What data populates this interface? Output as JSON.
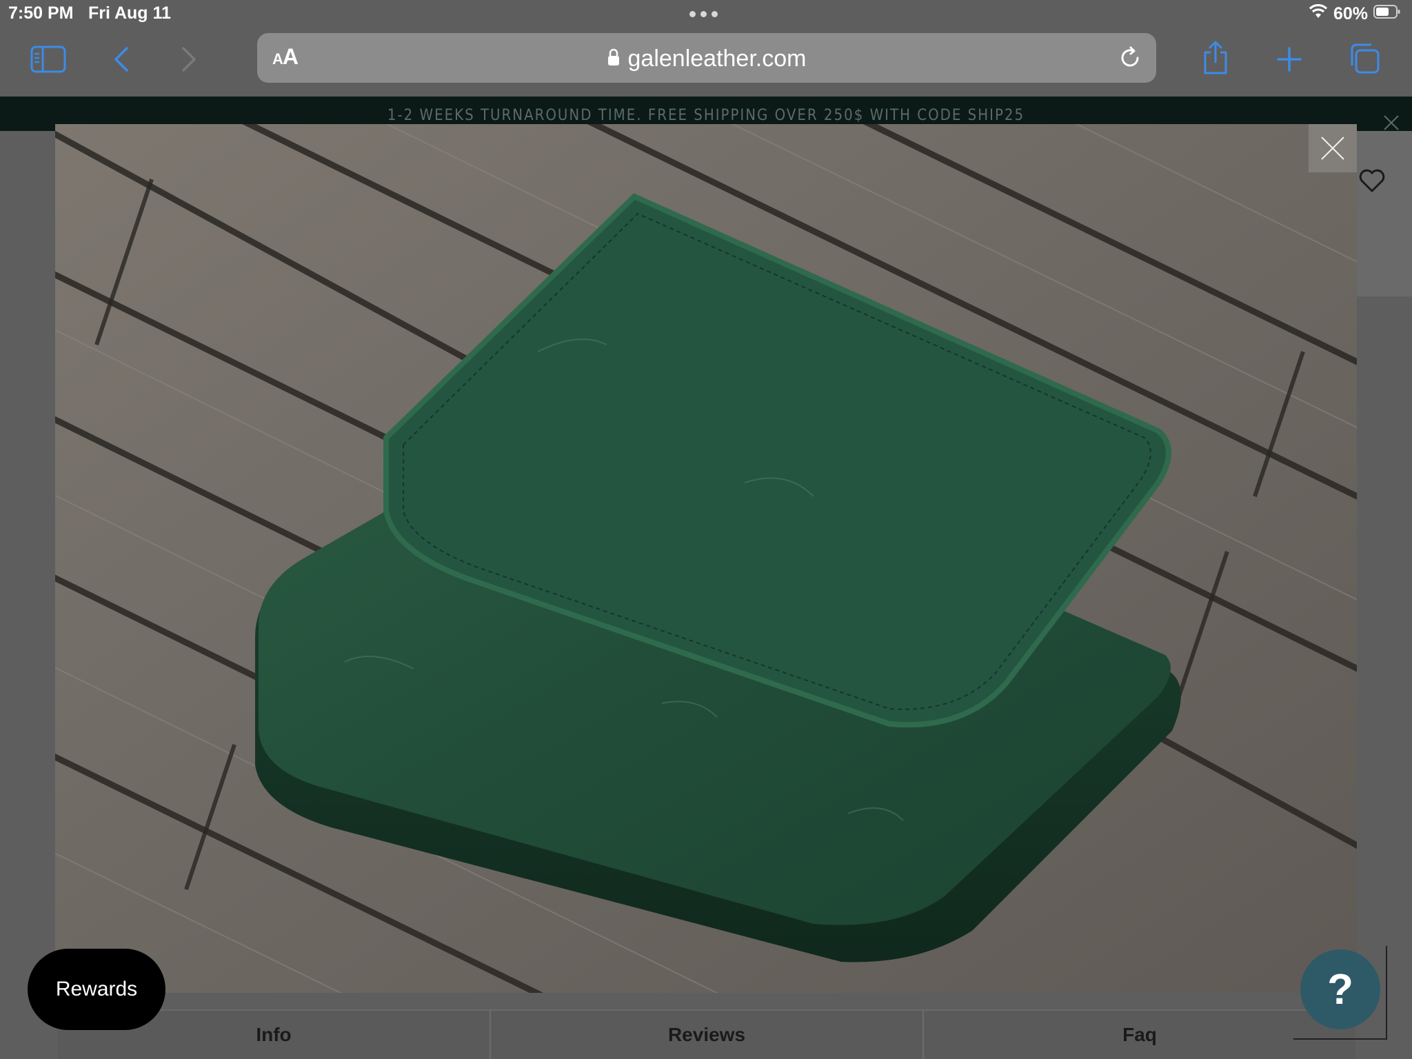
{
  "status": {
    "time": "7:50 PM",
    "date": "Fri Aug 11",
    "battery": "60%"
  },
  "browser": {
    "aa_small": "A",
    "aa_large": "A",
    "url": "galenleather.com"
  },
  "page": {
    "announcement": "1-2 WEEKS TURNAROUND TIME. FREE SHIPPING OVER 250$ WITH CODE SHIP25",
    "tabs": [
      {
        "label": "Info"
      },
      {
        "label": "Reviews"
      },
      {
        "label": "Faq"
      }
    ],
    "rewards_label": "Rewards",
    "help_label": "?"
  },
  "colors": {
    "leather_green": "#1f4a34",
    "announcement_bg": "#0c1a17",
    "help_button": "#2e5a68"
  }
}
